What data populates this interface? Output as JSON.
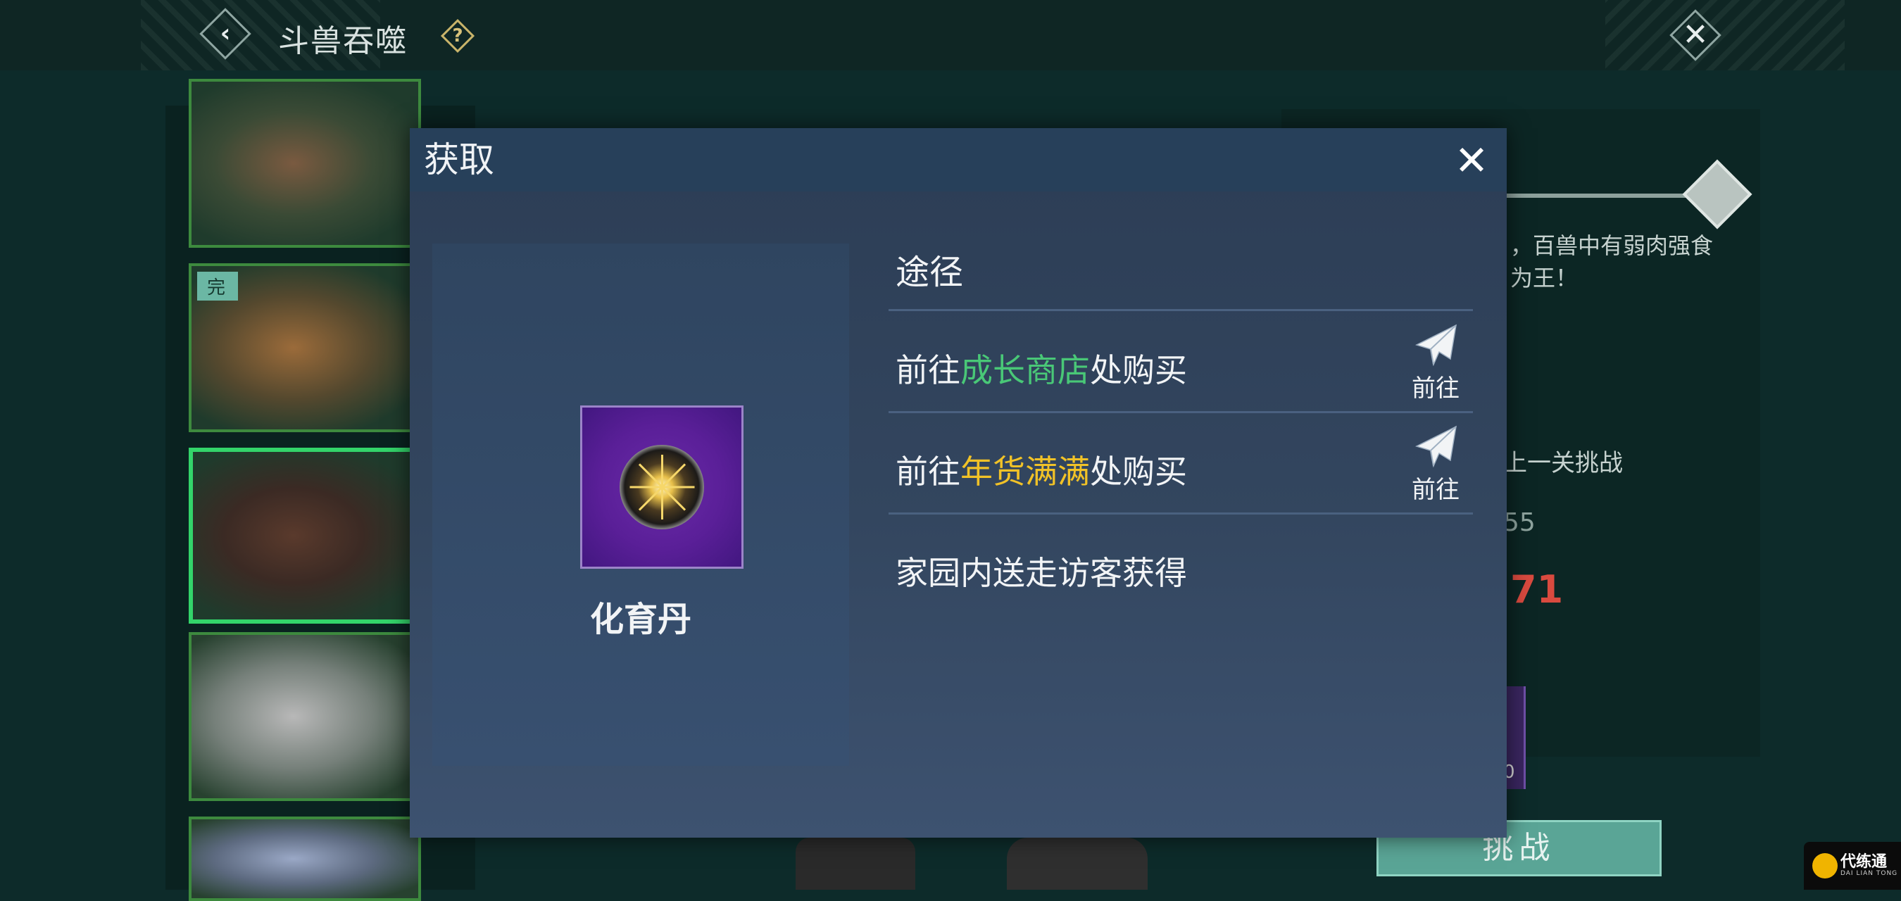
{
  "header": {
    "back_icon": "chevron-left-icon",
    "title": "斗兽吞噬",
    "help_icon": "question-icon",
    "help_glyph": "?",
    "close_icon": "close-icon"
  },
  "beast_list": [
    {
      "name": "beast-1",
      "done": false,
      "done_label": ""
    },
    {
      "name": "beast-2",
      "done": true,
      "done_label": "完"
    },
    {
      "name": "beast-3",
      "done": false,
      "done_label": "",
      "selected": true
    },
    {
      "name": "beast-4",
      "done": false,
      "done_label": ""
    },
    {
      "name": "beast-5",
      "done": false,
      "done_label": ""
    }
  ],
  "right_panel": {
    "story_line1": "，百兽中有弱肉强食",
    "story_line2": "为王！",
    "stage_text": "上一关挑战",
    "number_a": "55",
    "number_b": "71",
    "reward_count": "0",
    "challenge_label": "挑战",
    "accent_color": "#5aa596"
  },
  "modal": {
    "title": "获取",
    "close_icon": "close-icon",
    "item": {
      "name": "化育丹",
      "icon": "orb-icon",
      "frame_color": "#6a2aa8"
    },
    "ways_heading": "途径",
    "ways": [
      {
        "prefix": "前往",
        "highlight": "成长商店",
        "highlight_color": "#49c877",
        "suffix": "处购买",
        "has_go": true,
        "go_label": "前往",
        "go_icon": "paper-plane-icon"
      },
      {
        "prefix": "前往",
        "highlight": "年货满满",
        "highlight_color": "#f1c227",
        "suffix": "处购买",
        "has_go": true,
        "go_label": "前往",
        "go_icon": "paper-plane-icon"
      },
      {
        "prefix": "家园内送走访客获得",
        "highlight": "",
        "suffix": "",
        "has_go": false
      }
    ]
  },
  "watermark": {
    "text": "代练通",
    "sub": "DAI LIAN TONG"
  }
}
